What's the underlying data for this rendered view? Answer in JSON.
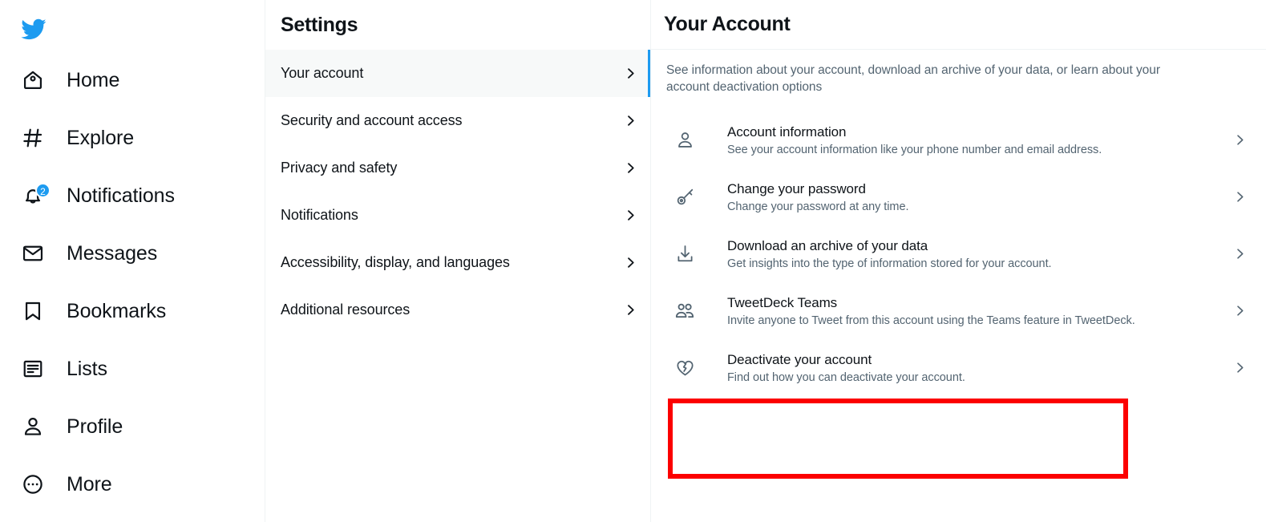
{
  "brand": {
    "logo_icon": "twitter-bird-icon",
    "accent_color": "#1d9bf0",
    "highlight_color": "#fc0000"
  },
  "sidebar": {
    "items": [
      {
        "label": "Home",
        "icon": "home-icon",
        "badge": null
      },
      {
        "label": "Explore",
        "icon": "hashtag-icon",
        "badge": null
      },
      {
        "label": "Notifications",
        "icon": "bell-icon",
        "badge": "2"
      },
      {
        "label": "Messages",
        "icon": "envelope-icon",
        "badge": null
      },
      {
        "label": "Bookmarks",
        "icon": "bookmark-icon",
        "badge": null
      },
      {
        "label": "Lists",
        "icon": "list-icon",
        "badge": null
      },
      {
        "label": "Profile",
        "icon": "person-icon",
        "badge": null
      },
      {
        "label": "More",
        "icon": "more-circle-icon",
        "badge": null
      }
    ]
  },
  "settings": {
    "title": "Settings",
    "items": [
      {
        "label": "Your account",
        "selected": true
      },
      {
        "label": "Security and account access",
        "selected": false
      },
      {
        "label": "Privacy and safety",
        "selected": false
      },
      {
        "label": "Notifications",
        "selected": false
      },
      {
        "label": "Accessibility, display, and languages",
        "selected": false
      },
      {
        "label": "Additional resources",
        "selected": false
      }
    ]
  },
  "main": {
    "title": "Your Account",
    "description": "See information about your account, download an archive of your data, or learn about your account deactivation options",
    "rows": [
      {
        "icon": "person-icon",
        "title": "Account information",
        "subtitle": "See your account information like your phone number and email address.",
        "highlighted": false
      },
      {
        "icon": "key-icon",
        "title": "Change your password",
        "subtitle": "Change your password at any time.",
        "highlighted": false
      },
      {
        "icon": "download-icon",
        "title": "Download an archive of your data",
        "subtitle": "Get insights into the type of information stored for your account.",
        "highlighted": false
      },
      {
        "icon": "people-icon",
        "title": "TweetDeck Teams",
        "subtitle": "Invite anyone to Tweet from this account using the Teams feature in TweetDeck.",
        "highlighted": false
      },
      {
        "icon": "broken-heart-icon",
        "title": "Deactivate your account",
        "subtitle": "Find out how you can deactivate your account.",
        "highlighted": true
      }
    ]
  }
}
